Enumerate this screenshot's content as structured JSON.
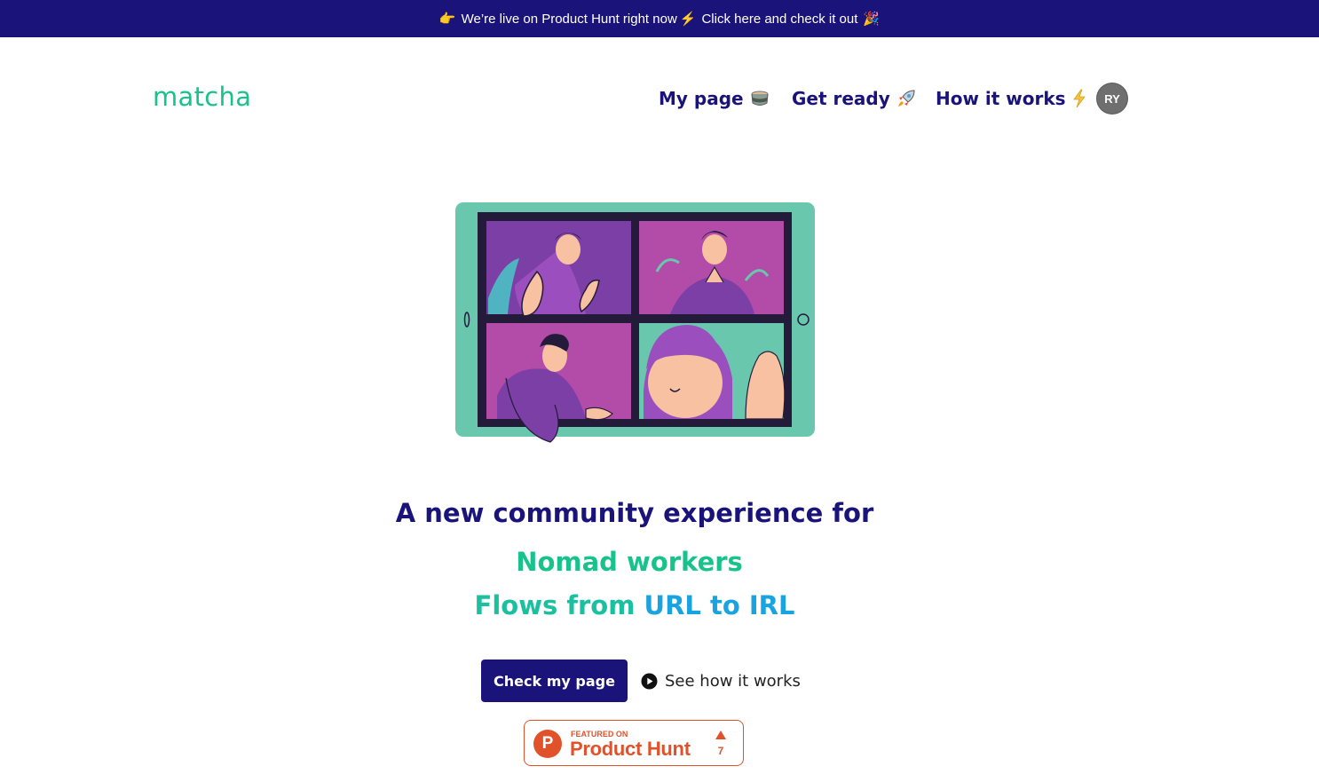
{
  "banner": {
    "pointing_emoji": "👉",
    "text1": "We’re live on Product Hunt right now",
    "bolt_emoji": "⚡",
    "text2": "Click here and check it out",
    "party_emoji": "🎉"
  },
  "header": {
    "logo": "matcha",
    "nav": [
      {
        "label": "My page",
        "emoji": "🍵"
      },
      {
        "label": "Get ready",
        "emoji": "🚀"
      },
      {
        "label": "How it works",
        "emoji": "⚡"
      }
    ],
    "avatar_initials": "RY"
  },
  "hero": {
    "headline": "A new community experience for",
    "rotating_line_1": "Nomad workers",
    "rotating_line_2_part1": "Flows from ",
    "rotating_line_2_part2": "URL to IRL",
    "primary_cta": "Check my page",
    "secondary_cta": "See how it works"
  },
  "product_hunt_badge": {
    "logo_letter": "P",
    "small_text": "FEATURED ON",
    "big_text": "Product Hunt",
    "upvotes": "7"
  },
  "colors": {
    "navy": "#1a137a",
    "green": "#17c38b",
    "teal": "#1ac0a0",
    "blue": "#19a3e0",
    "product_hunt_orange": "#e1522b"
  }
}
